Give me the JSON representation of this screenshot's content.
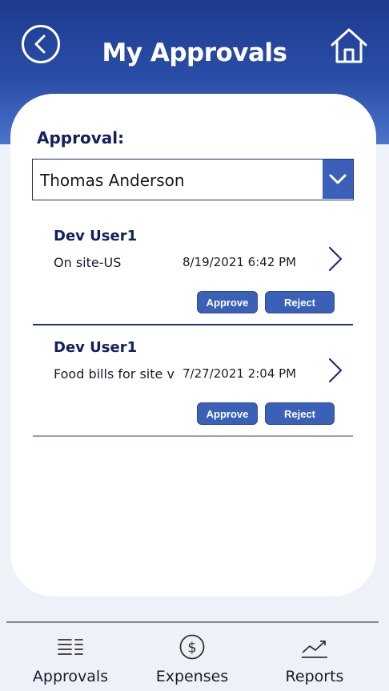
{
  "header": {
    "title": "My Approvals",
    "back_icon": "back-circle-icon",
    "home_icon": "home-icon"
  },
  "approval": {
    "label": "Approval:",
    "selected": "Thomas Anderson"
  },
  "items": [
    {
      "name": "Dev User1",
      "description": "On site-US",
      "date": "8/19/2021 6:42 PM",
      "approve_label": "Approve",
      "reject_label": "Reject"
    },
    {
      "name": "Dev User1",
      "description": "Food bills for site visit",
      "date": "7/27/2021 2:04 PM",
      "approve_label": "Approve",
      "reject_label": "Reject"
    }
  ],
  "nav": {
    "approvals": "Approvals",
    "expenses": "Expenses",
    "reports": "Reports"
  },
  "colors": {
    "brand_dark": "#1d3b8f",
    "accent": "#3a61b7",
    "title_text": "#13205c"
  }
}
